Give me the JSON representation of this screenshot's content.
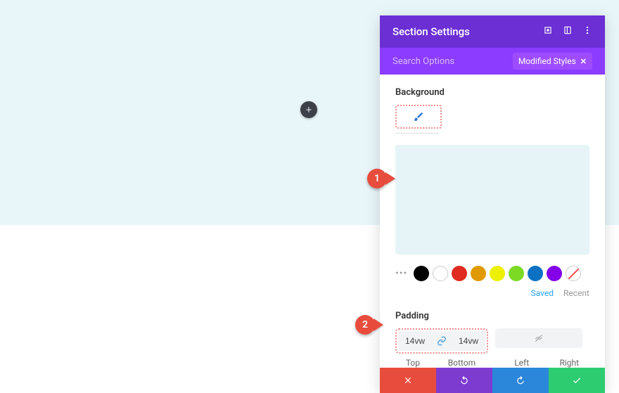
{
  "canvas": {
    "add_label": "+"
  },
  "panel": {
    "title": "Section Settings",
    "search_placeholder": "Search Options",
    "modified_chip": "Modified Styles",
    "background_label": "Background",
    "tabs": {
      "saved": "Saved",
      "recent": "Recent"
    },
    "padding_label": "Padding",
    "padding": {
      "top": "14vw",
      "bottom": "14vw",
      "left": "",
      "right": "",
      "labels": {
        "top": "Top",
        "bottom": "Bottom",
        "left": "Left",
        "right": "Right"
      }
    },
    "swatches": [
      "black",
      "white",
      "red",
      "orange",
      "yellow",
      "lime",
      "blue",
      "purple",
      "none"
    ]
  },
  "callouts": {
    "one": "1",
    "two": "2"
  }
}
